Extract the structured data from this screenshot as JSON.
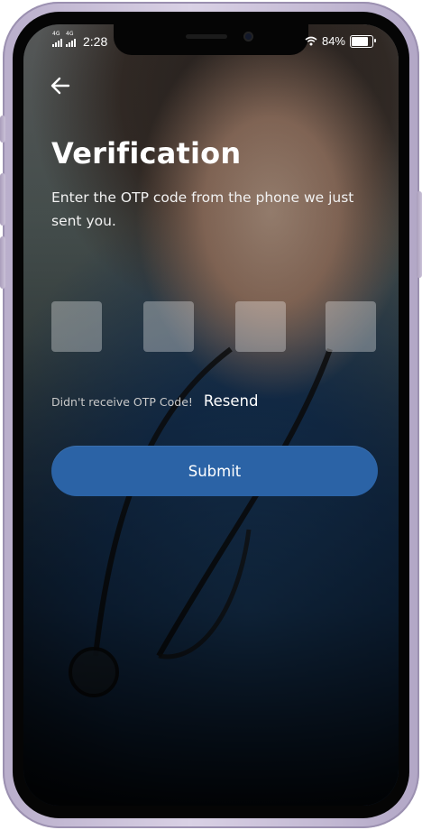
{
  "status_bar": {
    "network_1": "4G",
    "network_2": "4G",
    "time": "2:28",
    "battery_percent": "84%",
    "battery_level": 0.84
  },
  "nav": {
    "back_icon": "arrow-left-icon"
  },
  "verification": {
    "title": "Verification",
    "subtitle": "Enter the OTP code from the phone we just sent you.",
    "otp_digits": [
      "",
      "",
      "",
      ""
    ],
    "resend_prompt": "Didn't receive OTP Code!",
    "resend_label": "Resend",
    "submit_label": "Submit"
  },
  "colors": {
    "accent": "#2b63a6",
    "phone_frame": "#cfc6dd"
  }
}
